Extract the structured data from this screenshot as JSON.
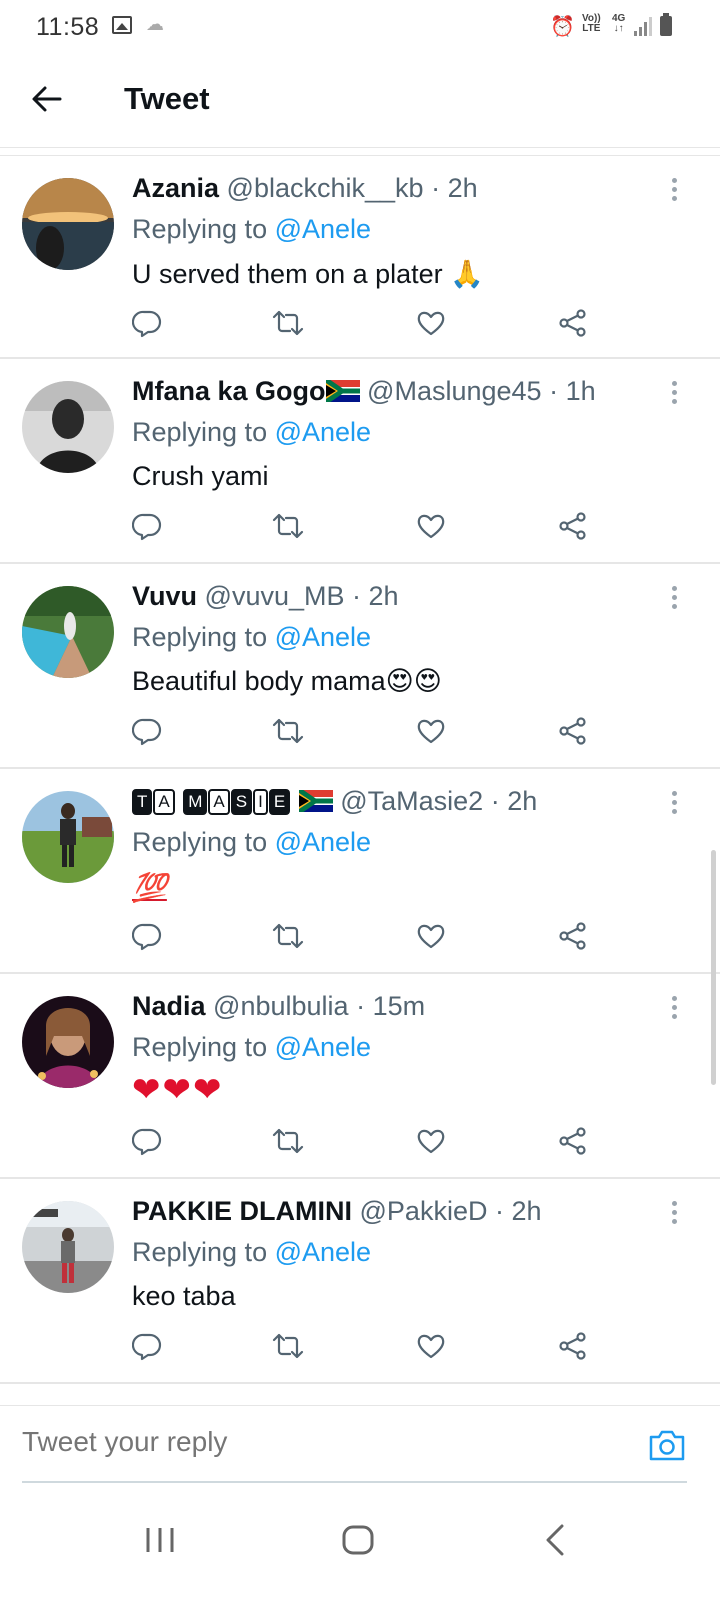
{
  "status_bar": {
    "time": "11:58",
    "icons": [
      "gallery-icon",
      "weather-icon",
      "alarm-icon",
      "volte-icon",
      "4g-icon",
      "signal-icon",
      "battery-icon"
    ],
    "volte_label": "Vo)) LTE",
    "network_label": "4G"
  },
  "header": {
    "back_icon": "arrow-left-icon",
    "title": "Tweet"
  },
  "replying_label": "Replying to",
  "mention": "@Anele",
  "tweets": [
    {
      "name": "Azania",
      "handle": "@blackchik__kb",
      "time": "2h",
      "text": "U served  them on a plater",
      "emoji": "🙏"
    },
    {
      "name": "Mfana ka Gogo",
      "handle": "@Maslunge45",
      "time": "1h",
      "text": "Crush yami",
      "emoji": ""
    },
    {
      "name": "Vuvu",
      "handle": "@vuvu_MB",
      "time": "2h",
      "text": "Beautiful body mama",
      "emoji": "😍😍"
    },
    {
      "name": "TA MASIE",
      "handle": "@TaMasie2",
      "time": "2h",
      "text": "",
      "emoji": "💯"
    },
    {
      "name": "Nadia",
      "handle": "@nbulbulia",
      "time": "15m",
      "text": "",
      "emoji": "❤❤❤"
    },
    {
      "name": "PAKKIE DLAMINI",
      "handle": "@PakkieD",
      "time": "2h",
      "text": "keo taba",
      "emoji": ""
    }
  ],
  "reply_bar": {
    "placeholder": "Tweet your reply"
  },
  "colors": {
    "accent": "#1d9bf0",
    "text": "#0f1419",
    "secondary": "#536471",
    "heart": "#e0102d"
  }
}
